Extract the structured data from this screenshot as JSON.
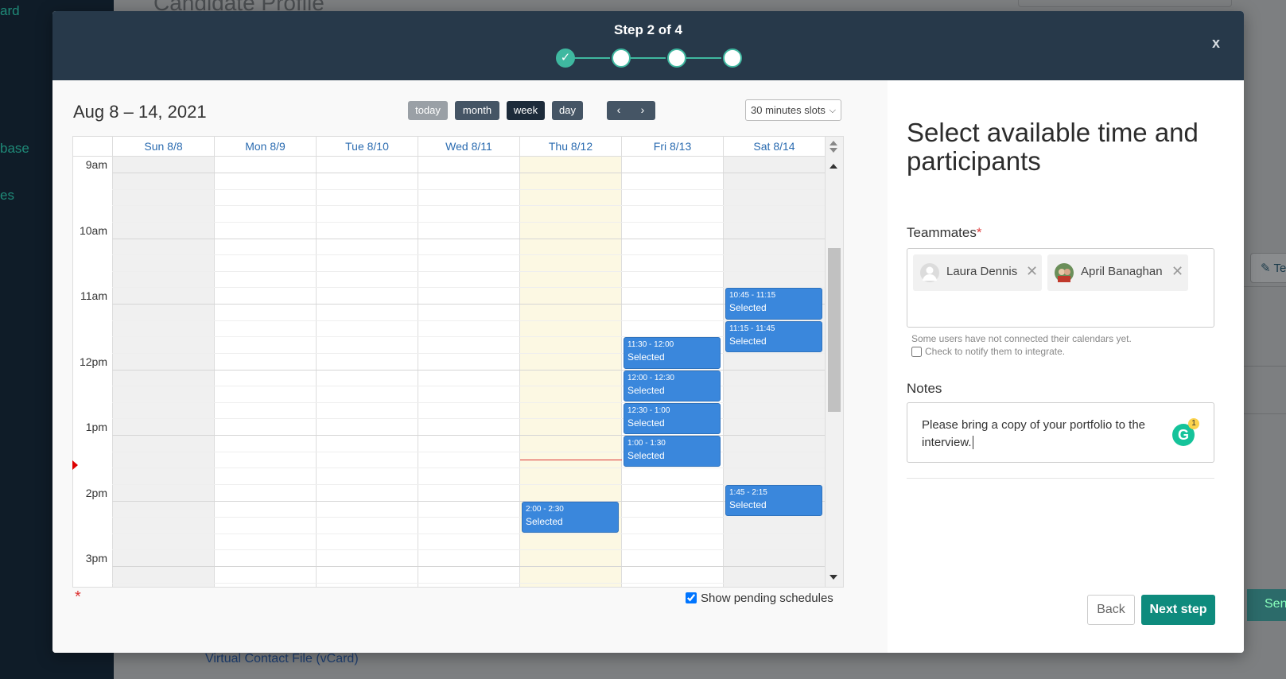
{
  "background": {
    "sidebar_items": [
      "ard",
      "base",
      "es"
    ],
    "page_title": "Candidate Profile",
    "side_tab_label": "Te",
    "side_button_label": "Sen",
    "vcard_link": "Virtual Contact File (vCard)"
  },
  "modal": {
    "step_title": "Step 2 of 4",
    "steps_total": 4,
    "current_step": 2,
    "close_label": "x"
  },
  "calendar": {
    "range_title": "Aug 8 – 14, 2021",
    "buttons": {
      "today": "today",
      "month": "month",
      "week": "week",
      "day": "day",
      "prev": "‹",
      "next": "›"
    },
    "active_view": "week",
    "slot_select": "30 minutes slots",
    "days": [
      "Sun 8/8",
      "Mon 8/9",
      "Tue 8/10",
      "Wed 8/11",
      "Thu 8/12",
      "Fri 8/13",
      "Sat 8/14"
    ],
    "time_labels": [
      "9am",
      "10am",
      "11am",
      "12pm",
      "1pm",
      "2pm",
      "3pm"
    ],
    "events": [
      {
        "day": 6,
        "time": "10:45 - 11:15",
        "label": "Selected"
      },
      {
        "day": 6,
        "time": "11:15 - 11:45",
        "label": "Selected"
      },
      {
        "day": 5,
        "time": "11:30 - 12:00",
        "label": "Selected"
      },
      {
        "day": 5,
        "time": "12:00 - 12:30",
        "label": "Selected"
      },
      {
        "day": 5,
        "time": "12:30 - 1:00",
        "label": "Selected"
      },
      {
        "day": 5,
        "time": "1:00 - 1:30",
        "label": "Selected"
      },
      {
        "day": 6,
        "time": "1:45 - 2:15",
        "label": "Selected"
      },
      {
        "day": 4,
        "time": "2:00 - 2:30",
        "label": "Selected"
      }
    ],
    "required_mark": "*",
    "show_pending_label": "Show pending schedules",
    "show_pending_checked": true
  },
  "panel": {
    "title": "Select available time and participants",
    "teammates_label": "Teammates",
    "required_mark": "*",
    "teammates": [
      {
        "name": "Laura Dennis",
        "remove": "✕"
      },
      {
        "name": "April Banaghan",
        "remove": "✕"
      }
    ],
    "calendar_hint": "Some users have not connected their calendars yet.",
    "notify_label": "Check to notify them to integrate.",
    "notes_label": "Notes",
    "notes_value": "Please bring a copy of your portfolio to the interview.",
    "grammarly_icon": "G",
    "grammarly_count": "1",
    "back_label": "Back",
    "next_label": "Next step"
  },
  "colors": {
    "header": "#27394a",
    "accent": "#3fb8a0",
    "event": "#3a87dc",
    "primary_button": "#0e8b7d",
    "today_column": "#fcf8e3"
  }
}
